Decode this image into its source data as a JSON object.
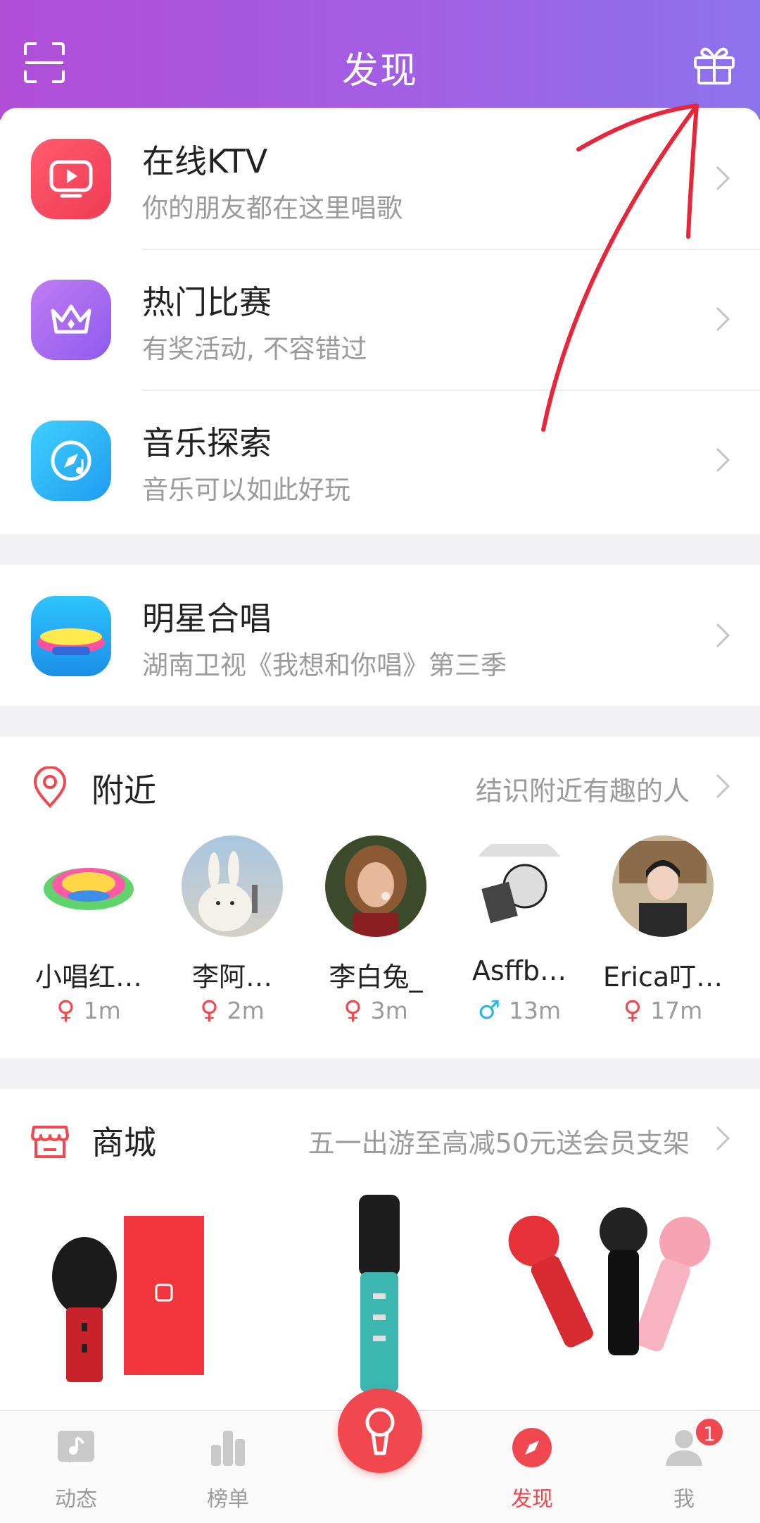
{
  "header": {
    "title": "发现"
  },
  "menu": [
    {
      "title": "在线KTV",
      "subtitle": "你的朋友都在这里唱歌"
    },
    {
      "title": "热门比赛",
      "subtitle": "有奖活动, 不容错过"
    },
    {
      "title": "音乐探索",
      "subtitle": "音乐可以如此好玩"
    }
  ],
  "star": {
    "title": "明星合唱",
    "subtitle": "湖南卫视《我想和你唱》第三季"
  },
  "nearby": {
    "title": "附近",
    "link": "结识附近有趣的人",
    "users": [
      {
        "name": "小唱红…",
        "gender": "♀",
        "distance": "1m"
      },
      {
        "name": "李阿…",
        "gender": "♀",
        "distance": "2m"
      },
      {
        "name": "李白兔_",
        "gender": "♀",
        "distance": "3m"
      },
      {
        "name": "Asffb…",
        "gender": "♂",
        "distance": "13m"
      },
      {
        "name": "Erica叮…",
        "gender": "♀",
        "distance": "17m"
      }
    ]
  },
  "shop": {
    "title": "商城",
    "link": "五一出游至高减50元送会员支架"
  },
  "tabs": [
    {
      "label": "动态"
    },
    {
      "label": "榜单"
    },
    {
      "label": ""
    },
    {
      "label": "发现"
    },
    {
      "label": "我"
    }
  ],
  "badge_count": "1",
  "colors": {
    "accent": "#f0484e",
    "header_start": "#b04ed6",
    "header_end": "#8c73ee",
    "male": "#29b6e6"
  }
}
